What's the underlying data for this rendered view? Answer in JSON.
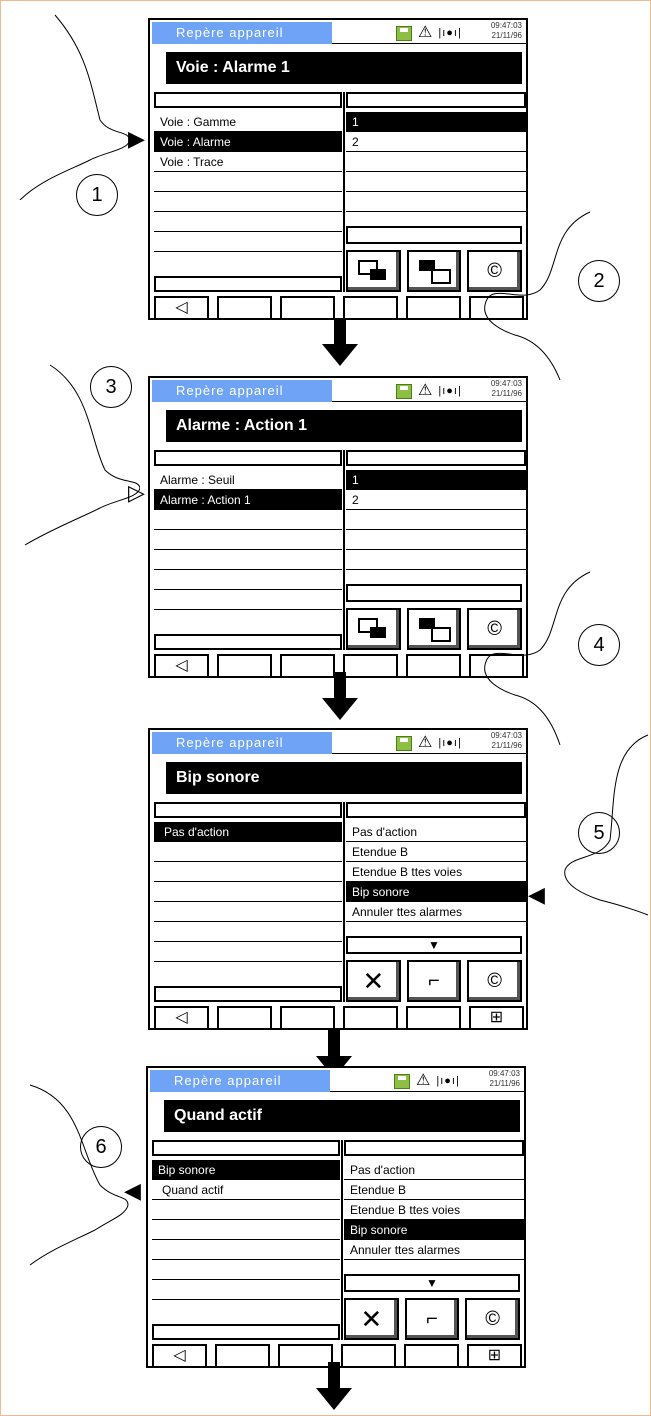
{
  "panels": [
    {
      "header_tab": "Repère appareil",
      "time": "09:47:03",
      "date": "21/11/96",
      "title": "Voie : Alarme 1",
      "left_rows": [
        "Voie : Gamme",
        "Voie : Alarme",
        "Voie : Trace",
        "",
        "",
        "",
        ""
      ],
      "left_selected": 1,
      "right_rows": [
        "1",
        "2",
        "",
        "",
        ""
      ],
      "right_selected": 0,
      "buttons": [
        "stack-out-icon",
        "stack-in-icon",
        "copy-c-icon"
      ],
      "softkeys": [
        "◁",
        "",
        "",
        "",
        "",
        ""
      ],
      "step_left": "1",
      "step_right": "2"
    },
    {
      "header_tab": "Repère appareil",
      "time": "09:47:03",
      "date": "21/11/96",
      "title": "Alarme : Action 1",
      "left_rows": [
        "Alarme : Seuil",
        "Alarme : Action 1",
        "",
        "",
        "",
        "",
        ""
      ],
      "left_selected": 1,
      "right_rows": [
        "1",
        "2",
        "",
        "",
        ""
      ],
      "right_selected": 0,
      "buttons": [
        "stack-out-icon",
        "stack-in-icon",
        "copy-c-icon"
      ],
      "softkeys": [
        "◁",
        "",
        "",
        "",
        "",
        ""
      ],
      "step_left": "3",
      "step_right": "4"
    },
    {
      "header_tab": "Repère appareil",
      "time": "09:47:03",
      "date": "21/11/96",
      "title": "Bip sonore",
      "left_rows": [
        "Pas d'action",
        "",
        "",
        "",
        "",
        "",
        ""
      ],
      "left_selected": 0,
      "right_rows": [
        "Pas d'action",
        "Etendue B",
        "Etendue B ttes voies",
        "Bip sonore",
        "Annuler ttes alarmes"
      ],
      "right_selected": 3,
      "buttons": [
        "cancel-x-icon",
        "enter-icon",
        "copy-c-icon"
      ],
      "softkeys": [
        "◁",
        "",
        "",
        "",
        "",
        "⊞"
      ],
      "step_right": "5"
    },
    {
      "header_tab": "Repère appareil",
      "time": "09:47:03",
      "date": "21/11/96",
      "title": "Quand actif",
      "left_rows": [
        "Bip sonore",
        "Quand actif",
        "",
        "",
        "",
        "",
        ""
      ],
      "left_selected": 0,
      "right_rows": [
        "Pas d'action",
        "Etendue B",
        "Etendue B ttes voies",
        "Bip sonore",
        "Annuler ttes alarmes"
      ],
      "right_selected": 3,
      "buttons": [
        "cancel-x-icon",
        "enter-icon",
        "copy-c-icon"
      ],
      "softkeys": [
        "◁",
        "",
        "",
        "",
        "",
        "⊞"
      ],
      "step_left": "6"
    }
  ]
}
